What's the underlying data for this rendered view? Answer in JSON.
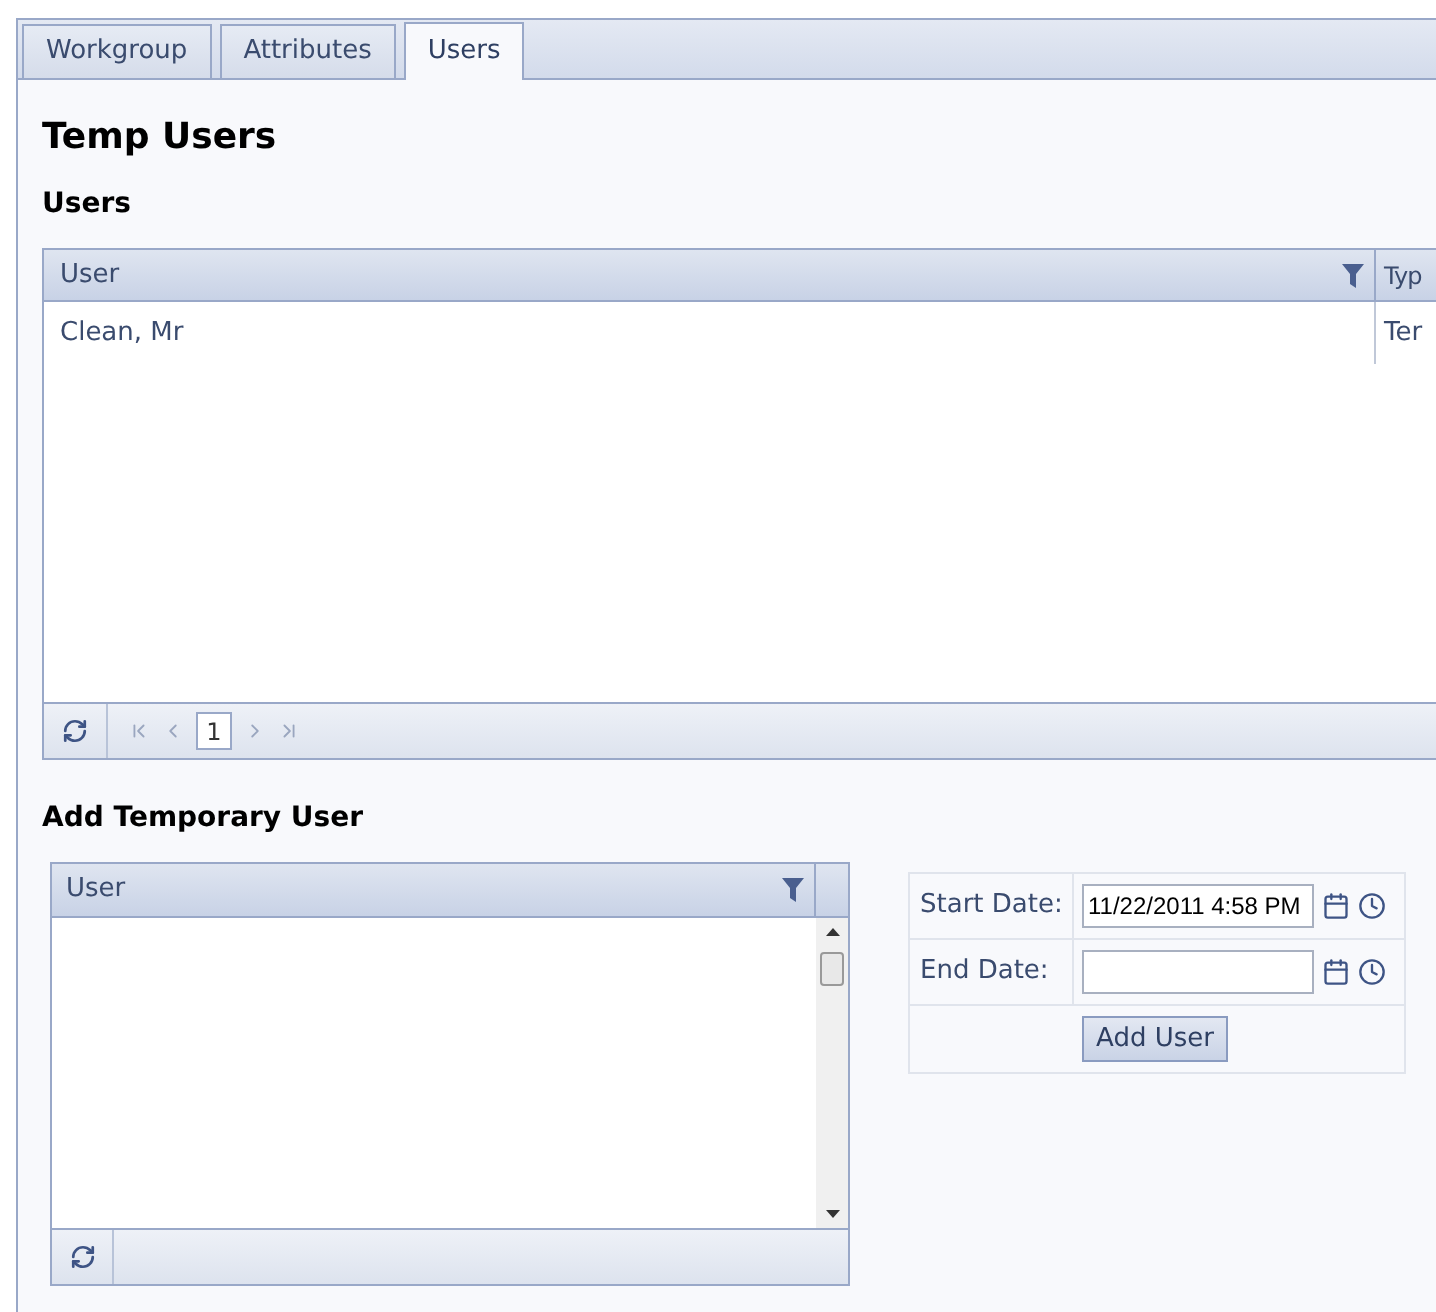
{
  "tabs": [
    {
      "label": "Workgroup",
      "selected": false
    },
    {
      "label": "Attributes",
      "selected": false
    },
    {
      "label": "Users",
      "selected": true
    }
  ],
  "title": "Temp Users",
  "users_section": {
    "heading": "Users",
    "grid": {
      "columns": [
        "User",
        "Typ"
      ],
      "rows": [
        [
          "Clean, Mr",
          "Ter"
        ]
      ],
      "pager": {
        "page": "1"
      }
    }
  },
  "add_section": {
    "heading": "Add Temporary User",
    "grid": {
      "columns": [
        "User"
      ]
    },
    "form": {
      "fields": [
        {
          "label": "Start Date:",
          "value": "11/22/2011 4:58 PM"
        },
        {
          "label": "End Date:"
        }
      ],
      "button": "Add User"
    }
  }
}
